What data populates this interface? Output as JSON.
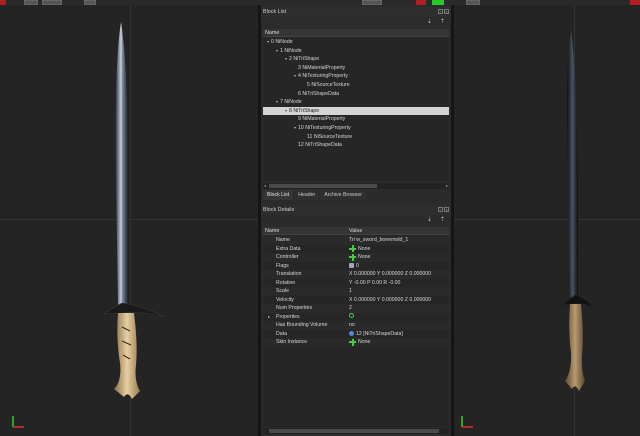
{
  "block_list": {
    "title": "Block List",
    "column": "Name",
    "rows": [
      {
        "label": "0 NiNode",
        "depth": 0,
        "expander": true
      },
      {
        "label": "1 NiNode",
        "depth": 1,
        "expander": true
      },
      {
        "label": "2 NiTriShape",
        "depth": 2,
        "expander": true
      },
      {
        "label": "3 NiMaterialProperty",
        "depth": 3,
        "expander": false
      },
      {
        "label": "4 NiTexturingProperty",
        "depth": 3,
        "expander": true
      },
      {
        "label": "5 NiSourceTexture",
        "depth": 4,
        "expander": false
      },
      {
        "label": "6 NiTriShapeData",
        "depth": 3,
        "expander": false
      },
      {
        "label": "7 NiNode",
        "depth": 1,
        "expander": true
      },
      {
        "label": "8 NiTriShape",
        "depth": 2,
        "expander": true,
        "selected": true
      },
      {
        "label": "9 NiMaterialProperty",
        "depth": 3,
        "expander": false
      },
      {
        "label": "10 NiTexturingProperty",
        "depth": 3,
        "expander": true
      },
      {
        "label": "11 NiSourceTexture",
        "depth": 4,
        "expander": false
      },
      {
        "label": "12 NiTriShapeData",
        "depth": 3,
        "expander": false
      }
    ]
  },
  "tabs": [
    {
      "label": "Block List",
      "active": true
    },
    {
      "label": "Header",
      "active": false
    },
    {
      "label": "Archive Browser",
      "active": false
    }
  ],
  "block_details": {
    "title": "Block Details",
    "col_name": "Name",
    "col_value": "Value",
    "rows": [
      {
        "name": "Name",
        "value": "Tri w_sword_bonemold_1",
        "icon": ""
      },
      {
        "name": "Extra Data",
        "value": "None",
        "icon": "plus"
      },
      {
        "name": "Controller",
        "value": "None",
        "icon": "plus"
      },
      {
        "name": "Flags",
        "value": "0",
        "icon": "flag"
      },
      {
        "name": "Translation",
        "value": "X 0.000000 Y 0.000000 Z 0.000000",
        "icon": ""
      },
      {
        "name": "Rotation",
        "value": "Y -0.00 P 0.00 R -0.00",
        "icon": ""
      },
      {
        "name": "Scale",
        "value": "1",
        "icon": ""
      },
      {
        "name": "Velocity",
        "value": "X 0.000000 Y 0.000000 Z 0.000000",
        "icon": ""
      },
      {
        "name": "Num Properties",
        "value": "2",
        "icon": ""
      },
      {
        "name": "Properties",
        "value": "",
        "icon": "refresh",
        "expander": true
      },
      {
        "name": "Has Bounding Volume",
        "value": "no",
        "icon": ""
      },
      {
        "name": "Data",
        "value": "12 [NiTriShapeData]",
        "icon": "link"
      },
      {
        "name": "Skin Instance",
        "value": "None",
        "icon": "plus"
      }
    ]
  },
  "colors": {
    "accent_green": "#3fd03f",
    "selection": "#d4d4d4",
    "axis_x": "#e03030",
    "axis_y": "#30d030"
  }
}
